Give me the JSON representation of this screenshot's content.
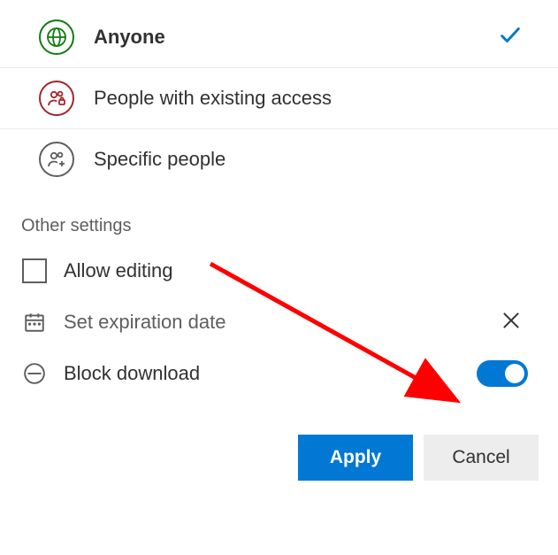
{
  "audience": {
    "items": [
      {
        "label": "Anyone",
        "selected": true,
        "icon": "globe",
        "color": "green"
      },
      {
        "label": "People with existing access",
        "selected": false,
        "icon": "people-lock",
        "color": "red"
      },
      {
        "label": "Specific people",
        "selected": false,
        "icon": "people-plus",
        "color": "gray"
      }
    ]
  },
  "settings": {
    "heading": "Other settings",
    "allow_editing": {
      "label": "Allow editing",
      "checked": false
    },
    "expiration": {
      "label": "Set expiration date"
    },
    "block_download": {
      "label": "Block download",
      "enabled": true
    }
  },
  "buttons": {
    "apply": "Apply",
    "cancel": "Cancel"
  },
  "colors": {
    "primary": "#0078d4",
    "green": "#107c10",
    "red": "#a4262c",
    "gray": "#605e5c"
  }
}
